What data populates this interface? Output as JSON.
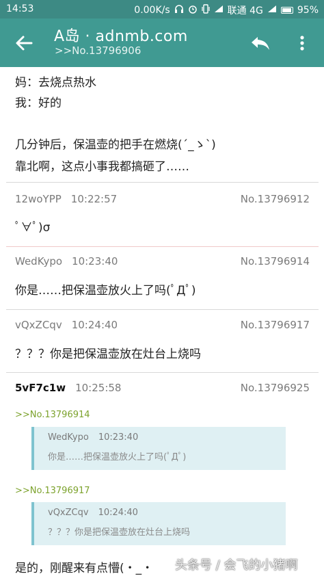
{
  "status_bar": {
    "time": "14:53",
    "speed": "0.00K/s",
    "carrier": "联通 4G",
    "battery": "95%",
    "icons": [
      "headphones-icon",
      "alarm-icon",
      "vibrate-icon",
      "signal-icon",
      "signal-icon",
      "battery-icon"
    ]
  },
  "toolbar": {
    "title": "A岛 · adnmb.com",
    "subtitle": ">>No.13796906",
    "back_icon": "arrow-left-icon",
    "reply_icon": "reply-icon",
    "more_icon": "more-vert-icon"
  },
  "op": {
    "lines": [
      "妈：去烧点热水",
      "我：好的",
      "几分钟后，保温壶的把手在燃烧(´_ゝ`)",
      "靠北啊，这点小事我都搞砸了……"
    ]
  },
  "replies": [
    {
      "uid": "12woYPP",
      "time": "10:22:57",
      "no": "No.13796912",
      "text": "ﾟ∀ﾟ)σ"
    },
    {
      "uid": "WedKypo",
      "time": "10:23:40",
      "no": "No.13796914",
      "text": "你是……把保温壶放火上了吗(ﾟДﾟ)"
    },
    {
      "uid": "vQxZCqv",
      "time": "10:24:40",
      "no": "No.13796917",
      "text": "？？？你是把保温壶放在灶台上烧吗"
    },
    {
      "uid": "5vF7c1w",
      "time": "10:25:58",
      "no": "No.13796925",
      "quotes": [
        {
          "ref": ">>No.13796914",
          "uid": "WedKypo",
          "time": "10:23:40",
          "text": "你是……把保温壶放火上了吗(ﾟДﾟ)"
        },
        {
          "ref": ">>No.13796917",
          "uid": "vQxZCqv",
          "time": "10:24:40",
          "text": "？？？你是把保温壶放在灶台上烧吗"
        }
      ],
      "text": "是的，刚醒来有点懵(・_・"
    }
  ],
  "watermark": "头条号 / 会飞的小猪啊"
}
